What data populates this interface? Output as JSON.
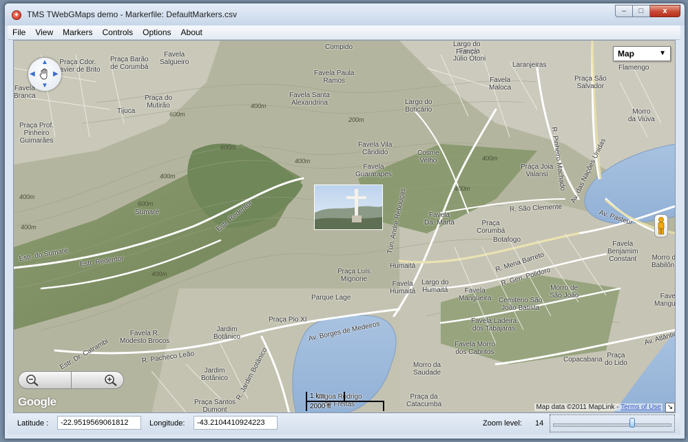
{
  "window": {
    "title": "TMS TWebGMaps demo - Markerfile: DefaultMarkers.csv",
    "min_glyph": "–",
    "max_glyph": "□",
    "close_glyph": "x"
  },
  "menu": [
    "File",
    "View",
    "Markers",
    "Controls",
    "Options",
    "About"
  ],
  "map": {
    "map_type": "Map",
    "logo_text": "Google",
    "copyright_text": "Map data ©2011 MapLink - ",
    "terms_link": "Terms of Use",
    "scale": {
      "km_label": "1 km",
      "ft_label": "2000 ft"
    },
    "places": [
      "Praça Cdor.\nXavier de Brito",
      "Praça Barão\nde Corumbá",
      "Favela\nSalgueiro",
      "Tijuca",
      "Praça do\nMutirão",
      "Praça Prof.\nPinheiro\nGuimarães",
      "Favela Paula\nRamos",
      "Favela Santa\nAlexandrina",
      "Largo do\nBoticário",
      "Favela Vila\nCândido",
      "Favela\nGuararapes",
      "Cosme\nVelho",
      "Favela\nJúlio Otoni",
      "Favela\nMaloca",
      "Laranjeiras",
      "Praça São\nSalvador",
      "Flamengo",
      "Morro\nda Viúva",
      "Praça Joia\nValansi",
      "Favela\nDa. Marta",
      "Praça\nCorumbá",
      "Botafogo",
      "Favela\nBenjamim\nConstant",
      "Morro de\nBabilônia",
      "Humaitá",
      "Praça Luís\nMignone",
      "Favela\nHumaitá",
      "Largo do\nHumaitá",
      "Favela\nMangueira",
      "Cemitério São\nJoão Batista",
      "Morro de\nSão João",
      "Parque Lage",
      "Praça Pio XI",
      "Jardim\nBotânico",
      "Favela R.\nModesto Brocos",
      "Jardim\nBotânico",
      "Praça Santos\nDumont",
      "Favela Ladeira\ndos Tabajaras",
      "Favela Morro\ndos Cabritos",
      "Morro da\nSaudade",
      "Praça da\nCatacumba",
      "Copacabana",
      "Praça\ndo Lido",
      "Sumaré",
      "Lagoa Rodrigo\nde Freitas",
      "Largo do\nFrança",
      "Compido",
      "Favela\nBranca",
      "Favela\nMangueira"
    ],
    "streets": [
      "Estr. do Sumaré",
      "Estr. Redentor",
      "Estr. Redentor",
      "Estr. Dr. Catrambi",
      "R. Pacheco Leão",
      "R. Jardim Botânico",
      "Av. Borges de Medeiros",
      "Tún. André Rebouças",
      "R. São Clemente",
      "R. Mena Barreto",
      "R. Gen. Polidoro",
      "R. Pinheiro Machado",
      "Av. das Nações Unidas",
      "Av. Pasteur",
      "Av. Atlântica"
    ],
    "contours": [
      "600m",
      "400m",
      "600m",
      "400m",
      "400m",
      "400m",
      "600m",
      "400m",
      "400m",
      "200m",
      "400m",
      "400m"
    ]
  },
  "status": {
    "latitude_label": "Latitude :",
    "latitude_value": "-22.9519569061812",
    "longitude_label": "Longitude:",
    "longitude_value": "-43.2104410924223",
    "zoom_label": "Zoom level:",
    "zoom_value": "14",
    "zoom_min": 0,
    "zoom_max": 21
  }
}
